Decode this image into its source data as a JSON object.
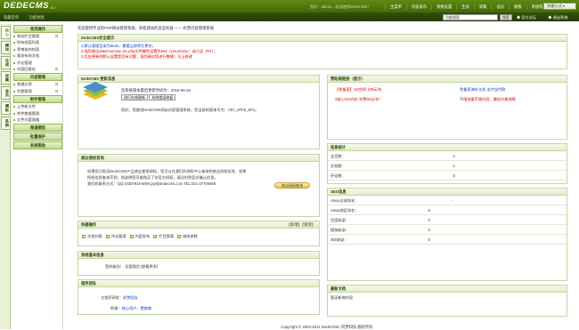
{
  "brand": {
    "logo": "DEDECMS",
    "version": "v5.7"
  },
  "top": {
    "welcome": "您好：admin，欢迎使用DedeCMS！",
    "nav": [
      "主菜单",
      "内容发布",
      "系统设置",
      "生成",
      "采集",
      "会员",
      "模板",
      "系统帮助",
      "官方网站"
    ],
    "quick_button": "快捷方式"
  },
  "bar2": {
    "links": [
      "隐藏菜单",
      "功能地图"
    ],
    "search_value": "功能搜索",
    "search_button": "搜索",
    "right_links": [
      "官方论坛",
      "退出系统"
    ]
  },
  "vtabs": [
    "核心",
    "模块",
    "生成",
    "采集",
    "会员",
    "模板",
    "系统"
  ],
  "sidebar": {
    "sections": [
      {
        "title": "常用操作",
        "items": [
          "网站栏目管理",
          "所有档案列表",
          "等审核的档案",
          "我发布的文档",
          "评论管理",
          "内容回收站"
        ]
      },
      {
        "title": "内容管理",
        "items": [
          "普通文章",
          "专题管理"
        ]
      },
      {
        "title": "附件管理",
        "items": [
          "上传新文件",
          "附件数据管理",
          "文件式管理器"
        ]
      },
      {
        "title": "频道模型",
        "items": []
      },
      {
        "title": "批量维护",
        "items": []
      },
      {
        "title": "系统帮助",
        "items": []
      }
    ]
  },
  "main": {
    "crumb": "欢迎使用专业的PHP网站管理系统，轻松建站的首选利器 —— 织梦内容管理系统",
    "security": {
      "title": "DedeCMS安全提示",
      "notes": [
        "1.默认管理目录为dede，需要立即将它更名；",
        "2.强烈建议data/common.inc.php文件属性设置为644（Linux/Unix）或只读（NT）；",
        "3.后台更新的默认设置是否有问题，强烈建议您进行整理！马上修改"
      ]
    },
    "update": {
      "title": "DedeCMS 更新消息",
      "line1": "您系统版本最后更新时间为：2015-06-18",
      "btn1": "进行在线更新",
      "btn2": "系统错误修复",
      "line2": "您好，您使用DedeCMS网站内容管理系统，您当前的版本号为：V57_UTF8_SP1。"
    },
    "business": {
      "title": "商业授权咨询",
      "lines": [
        "如果您已购买DedeCMS产品商业使用授权，您可以在我们的授权中心查询到商业授权信息，如果",
        "授权信息查询不到，则说明您可能购买了非官方授权，请及时到官方确认信息。",
        "我们的联系方式：QQ:10307919 MSN:jay@dedecms.com TEL:021-37709569"
      ],
      "button": "商业授权查询"
    },
    "shortcuts": {
      "title": "快捷操作",
      "extra": "【新增】【管理】",
      "items": [
        "文档列表",
        "评论管理",
        "内容发布",
        "栏目管理",
        "修改参数"
      ]
    },
    "sysinfo": {
      "title": "系统基本信息",
      "label": "您的级别：",
      "value": "总管理员 [查看更多]"
    },
    "team": {
      "title": "程序团队",
      "rows": [
        {
          "k": "主程序研发：",
          "v": "织梦团队"
        },
        {
          "k": "鸣谢：",
          "v": "热心用户、赞助商"
        }
      ]
    }
  },
  "right": {
    "sponsor": {
      "title": "赞助商链接（提示）",
      "links": [
        "【免备案】US空间 100元/年",
        "免备案海外主机 支付宝付款",
        "2核心/1G内存 年费50元/年！",
        "不限流量不限内容、最低价格保障"
      ]
    },
    "stats": {
      "title": "信息统计",
      "rows": [
        {
          "k": "会员数：",
          "v": "1"
        },
        {
          "k": "文档数：",
          "v": "1"
        },
        {
          "k": "评论数：",
          "v": "0"
        }
      ]
    },
    "seo": {
      "title": "SEO信息",
      "rows": [
        {
          "k": "Alexa全球排名：",
          "v": "-"
        },
        {
          "k": "Alexa地区排名：",
          "v": "0"
        },
        {
          "k": "百度收录：",
          "v": "0"
        },
        {
          "k": "搜狗收录：",
          "v": "0"
        },
        {
          "k": "360收录：",
          "v": "0"
        }
      ]
    },
    "latest": {
      "title": "最新文档",
      "text": "暂无新增内容"
    }
  },
  "footer": "Copyright © 2004-2011 DedeCMS. 织梦科技 版权所有",
  "colors": {
    "topbar": "#5f8a12",
    "accent": "#6b8e23",
    "warning": "#d40000",
    "link": "#0040c0"
  }
}
